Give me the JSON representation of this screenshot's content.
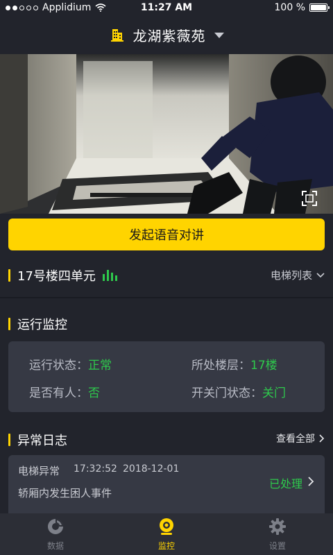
{
  "status_bar": {
    "carrier": "Applidium",
    "time": "11:27 AM",
    "battery": "100 %"
  },
  "header": {
    "community_name": "龙湖紫薇苑"
  },
  "video": {
    "fullscreen_icon": "fullscreen-icon"
  },
  "voice_button": {
    "label": "发起语音对讲"
  },
  "elevator": {
    "unit_name": "17号楼四单元",
    "list_label": "电梯列表"
  },
  "monitor": {
    "title": "运行监控",
    "items": [
      {
        "label": "运行状态：",
        "value": "正常"
      },
      {
        "label": "所处楼层：",
        "value": "17楼"
      },
      {
        "label": "是否有人：",
        "value": "否"
      },
      {
        "label": "开关门状态：",
        "value": "关门"
      }
    ]
  },
  "logs": {
    "title": "异常日志",
    "view_all": "查看全部",
    "entries": [
      {
        "type": "电梯异常",
        "time": "17:32:52",
        "date": "2018-12-01",
        "description": "轿厢内发生困人事件",
        "status": "已处理"
      }
    ]
  },
  "tabbar": {
    "tabs": [
      {
        "label": "数据",
        "icon": "data-chart-icon"
      },
      {
        "label": "监控",
        "icon": "camera-icon"
      },
      {
        "label": "设置",
        "icon": "gear-icon"
      }
    ]
  },
  "colors": {
    "accent": "#ffd400",
    "success": "#2ec94c",
    "background": "#22242c",
    "card": "#363944"
  }
}
